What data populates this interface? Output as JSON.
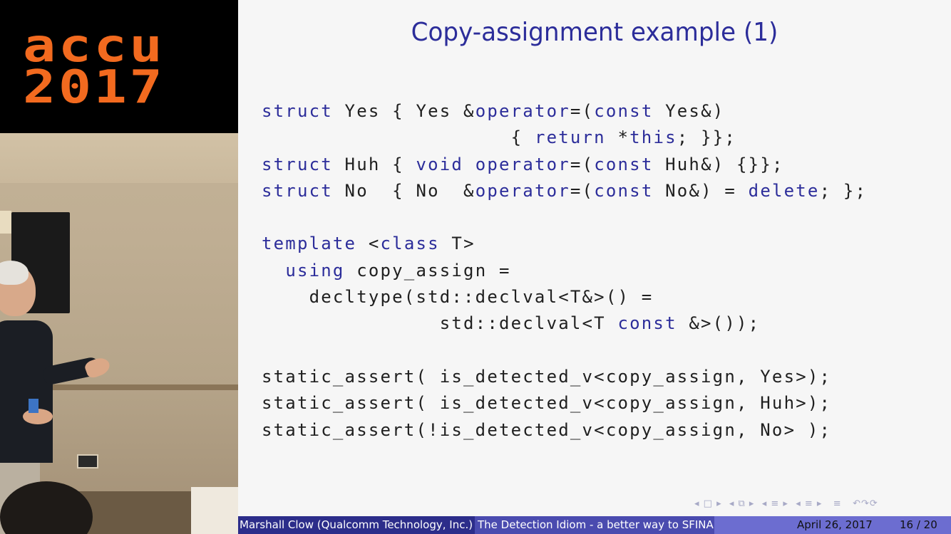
{
  "logo": {
    "line1": "accu",
    "line2": "2017"
  },
  "slide": {
    "title": "Copy-assignment example (1)",
    "code_lines": [
      [
        {
          "t": "struct",
          "kw": true
        },
        {
          "t": " Yes { Yes &"
        },
        {
          "t": "operator",
          "kw": true
        },
        {
          "t": "=("
        },
        {
          "t": "const",
          "kw": true
        },
        {
          "t": " Yes&)"
        }
      ],
      [
        {
          "t": "                     { "
        },
        {
          "t": "return",
          "kw": true
        },
        {
          "t": " *"
        },
        {
          "t": "this",
          "kw": true
        },
        {
          "t": "; }};"
        }
      ],
      [
        {
          "t": "struct",
          "kw": true
        },
        {
          "t": " Huh { "
        },
        {
          "t": "void",
          "kw": true
        },
        {
          "t": " "
        },
        {
          "t": "operator",
          "kw": true
        },
        {
          "t": "=("
        },
        {
          "t": "const",
          "kw": true
        },
        {
          "t": " Huh&) {}};"
        }
      ],
      [
        {
          "t": "struct",
          "kw": true
        },
        {
          "t": " No  { No  &"
        },
        {
          "t": "operator",
          "kw": true
        },
        {
          "t": "=("
        },
        {
          "t": "const",
          "kw": true
        },
        {
          "t": " No&) = "
        },
        {
          "t": "delete",
          "kw": true
        },
        {
          "t": "; };"
        }
      ],
      [
        {
          "t": ""
        }
      ],
      [
        {
          "t": "template",
          "kw": true
        },
        {
          "t": " <"
        },
        {
          "t": "class",
          "kw": true
        },
        {
          "t": " T>"
        }
      ],
      [
        {
          "t": "  "
        },
        {
          "t": "using",
          "kw": true
        },
        {
          "t": " copy_assign ="
        }
      ],
      [
        {
          "t": "    decltype(std::declval<T&>() ="
        }
      ],
      [
        {
          "t": "               std::declval<T "
        },
        {
          "t": "const",
          "kw": true
        },
        {
          "t": " &>());"
        }
      ],
      [
        {
          "t": ""
        }
      ],
      [
        {
          "t": "static_assert( is_detected_v<copy_assign, Yes>);"
        }
      ],
      [
        {
          "t": "static_assert( is_detected_v<copy_assign, Huh>);"
        }
      ],
      [
        {
          "t": "static_assert(!is_detected_v<copy_assign, No> );"
        }
      ]
    ],
    "nav_symbols": "◂ □ ▸  ◂ ⧉ ▸  ◂ ≡ ▸  ◂ ≡ ▸   ≡   ↶↷⟳"
  },
  "footer": {
    "author": "Marshall Clow  (Qualcomm Technology, Inc.)",
    "talk_title": "The Detection Idiom - a better way to SFINA",
    "date": "April 26, 2017",
    "page": "16 / 20"
  },
  "colors": {
    "keyword": "#2c2d9a",
    "footer_dark": "#2c2d8a",
    "footer_mid": "#4a4baf",
    "footer_light": "#6c6dd0",
    "logo_orange": "#f26a1f"
  }
}
